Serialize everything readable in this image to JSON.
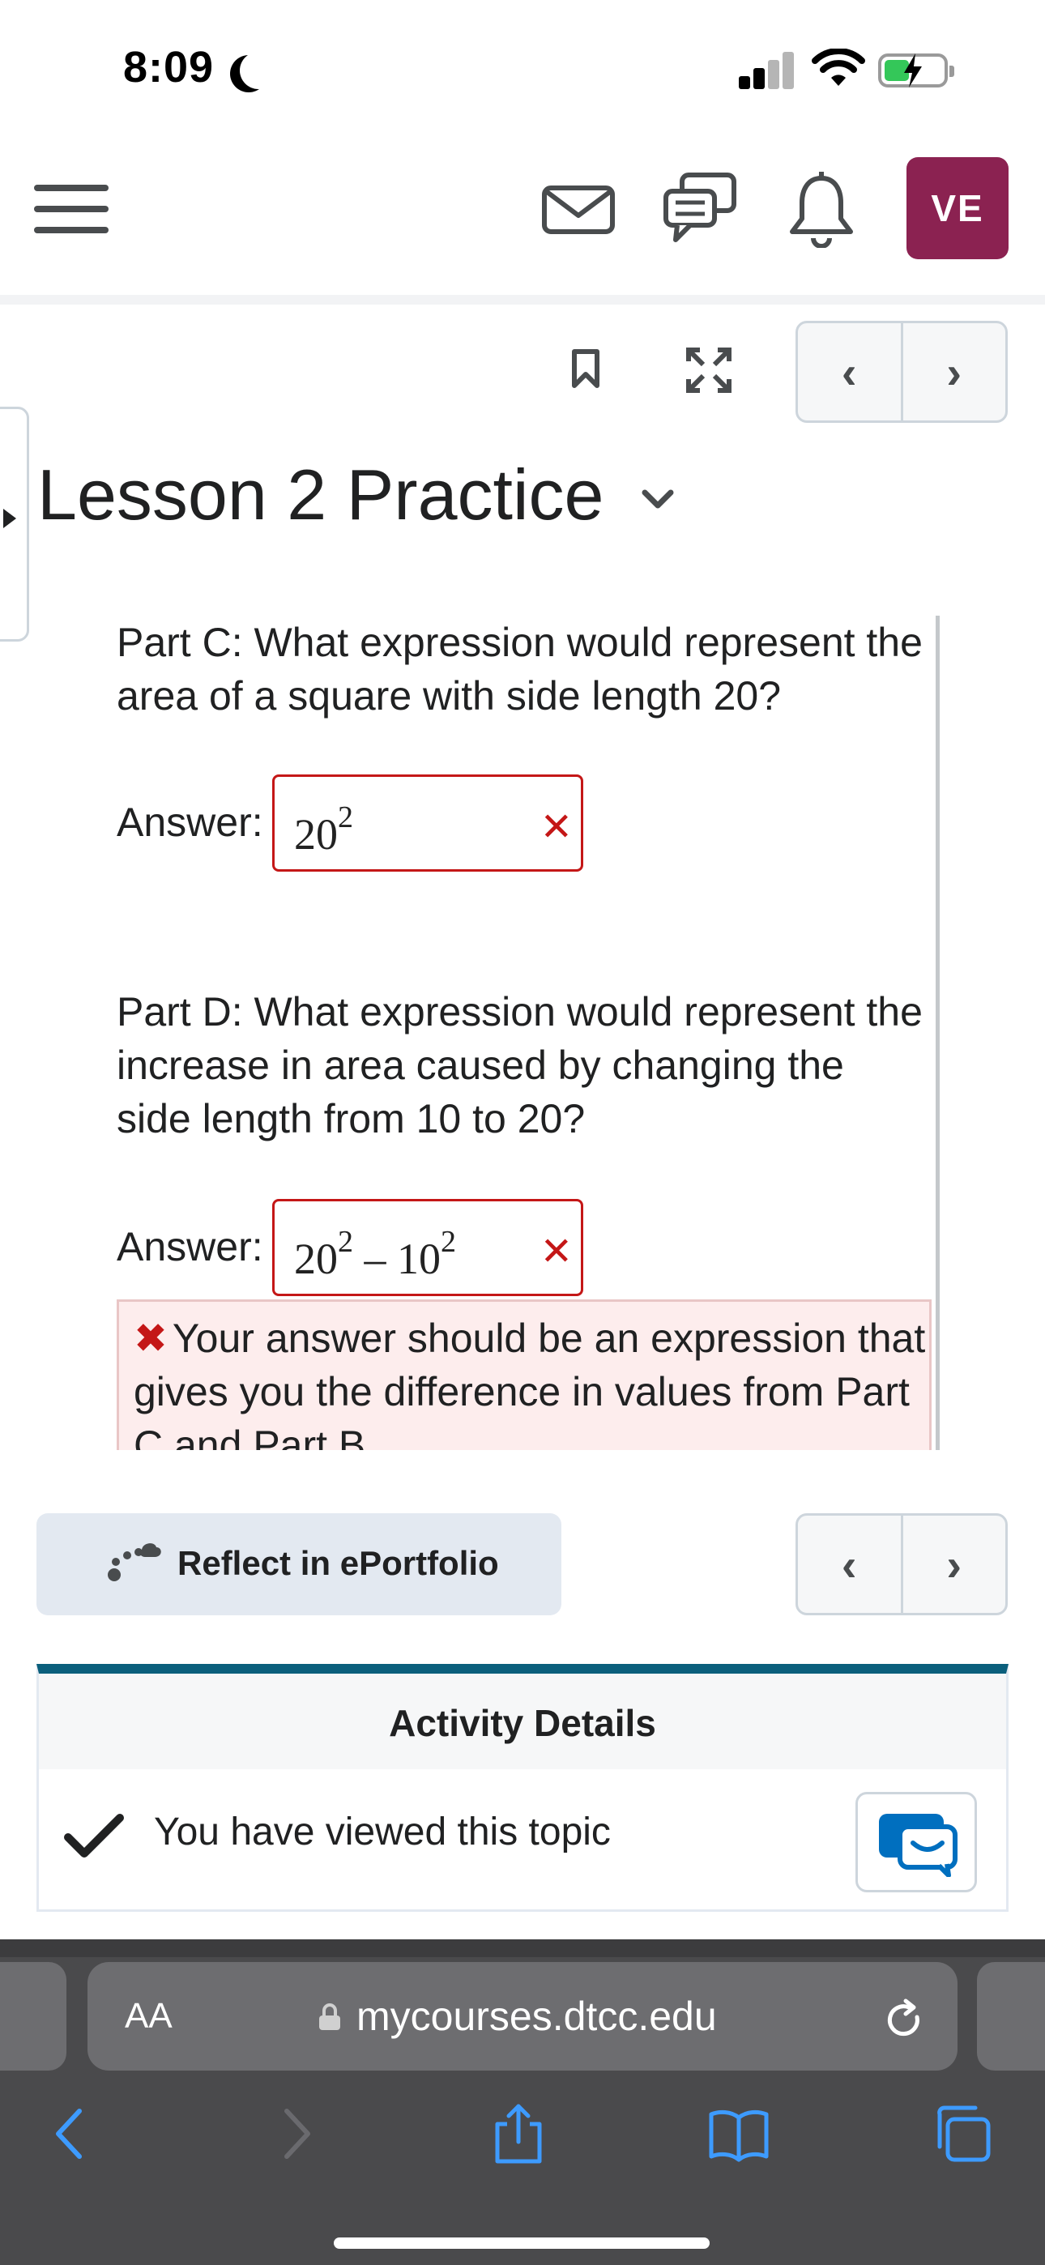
{
  "status_bar": {
    "time": "8:09"
  },
  "header": {
    "avatar_initials": "VE"
  },
  "lesson": {
    "title": "Lesson 2 Practice"
  },
  "part_c": {
    "question": "Part C: What expression would represent the area of a square with side length 20?",
    "answer_label": "Answer:",
    "answer_base": "20",
    "answer_exp": "2"
  },
  "part_d": {
    "question": "Part D: What expression would represent the increase in area caused by changing the side length from 10 to 20?",
    "answer_label": "Answer:",
    "answer_base1": "20",
    "answer_exp1": "2",
    "answer_op": " – ",
    "answer_base2": "10",
    "answer_exp2": "2",
    "feedback": "Your answer should be an expression that gives you the difference in values from Part C and Part B."
  },
  "reflect": {
    "label": "Reflect in ePortfolio"
  },
  "activity": {
    "title": "Activity Details",
    "status": "You have viewed this topic"
  },
  "safari": {
    "text_size_label": "AA",
    "url": "mycourses.dtcc.edu"
  },
  "colors": {
    "avatar": "#8b2251",
    "error": "#c41717",
    "feedback_bg": "#fdeded",
    "accent_bar": "#0b5f7c",
    "chat_icon": "#006fbf"
  }
}
